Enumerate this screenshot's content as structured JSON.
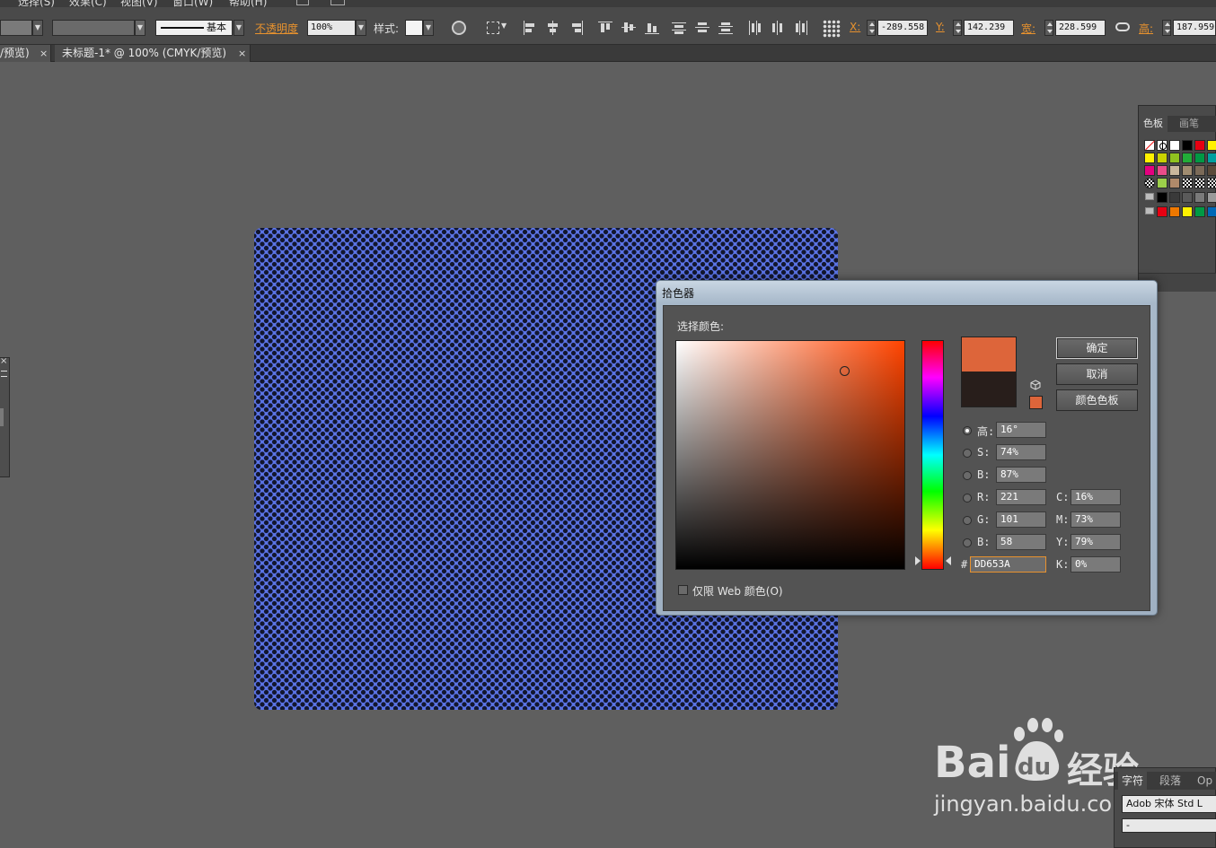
{
  "menu": [
    "选择(S)",
    "效果(C)",
    "视图(V)",
    "窗口(W)",
    "帮助(H)"
  ],
  "control_bar": {
    "stroke_profile": "基本",
    "opacity_label": "不透明度",
    "opacity_value": "100%",
    "style_label": "样式:",
    "x_label": "X:",
    "x_value": "-289.558",
    "y_label": "Y:",
    "y_value": "142.239",
    "w_label": "宽:",
    "w_value": "228.599",
    "h_label": "高:",
    "h_value": "187.959"
  },
  "tabs": [
    {
      "label": "/预览)",
      "close": "×"
    },
    {
      "label": "未标题-1* @ 100% (CMYK/预览)",
      "close": "×"
    }
  ],
  "artwork": {
    "fill_color": "#5b74e6",
    "dot_color": "#12162e"
  },
  "swatch_panel": {
    "tabs": [
      "色板",
      "画笔"
    ],
    "colors": [
      [
        "#ffffff",
        "#000000",
        "#e60012",
        "#fff100"
      ],
      [
        "#fff100",
        "#c9d200",
        "#8fc31f",
        "#22ac38",
        "#009944"
      ],
      [
        "#e4007f",
        "#e4007f",
        "#c9b79c",
        "#a08c70",
        "#7b6a58",
        "#5b4a3a"
      ],
      [
        "#000000",
        "#3a3a3a",
        "#5a5a5a",
        "#7a7a7a",
        "#9a9a9a"
      ],
      [
        "#e60012",
        "#ee7800",
        "#fff100",
        "#009944",
        "#0068b7"
      ]
    ]
  },
  "picker": {
    "title": "拾色器",
    "select_label": "选择颜色:",
    "hue_color": "#ff4400",
    "new_color": "#dd653a",
    "old_color": "#281e1b",
    "buttons": {
      "ok": "确定",
      "cancel": "取消",
      "swatches": "颜色色板"
    },
    "hsb": [
      {
        "label": "高:",
        "value": "16°",
        "selected": true
      },
      {
        "label": "S:",
        "value": "74%",
        "selected": false
      },
      {
        "label": "B:",
        "value": "87%",
        "selected": false
      }
    ],
    "rgb": [
      {
        "label": "R:",
        "value": "221"
      },
      {
        "label": "G:",
        "value": "101"
      },
      {
        "label": "B:",
        "value": "58"
      }
    ],
    "cmyk": [
      {
        "label": "C:",
        "value": "16%"
      },
      {
        "label": "M:",
        "value": "73%"
      },
      {
        "label": "Y:",
        "value": "79%"
      },
      {
        "label": "K:",
        "value": "0%"
      }
    ],
    "hex_label": "#",
    "hex_value": "DD653A",
    "web_only_label": "仅限 Web 颜色(O)"
  },
  "watermark": {
    "brand": "Bai",
    "brand_du": "du",
    "brand_cn": "经验",
    "url": "jingyan.baidu.com"
  },
  "char_panel": {
    "tabs": [
      "字符",
      "段落",
      "Op"
    ],
    "font_prefix": "Adob",
    "font_name": "宋体 Std L",
    "font_style": "-"
  }
}
